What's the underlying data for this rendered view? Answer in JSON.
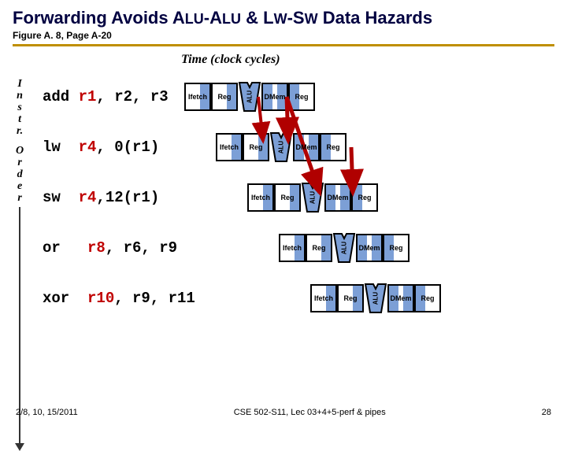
{
  "title": {
    "main_a": "Forwarding Avoids A",
    "main_b": "-A",
    "main_c": " & L",
    "main_d": "-S",
    "main_e": " Data Hazards",
    "sc_alu1": "LU",
    "sc_alu2": "LU",
    "sc_lw": "W",
    "sc_sw": "W"
  },
  "subtitle": "Figure A. 8, Page A-20",
  "time_label": "Time (clock cycles)",
  "vaxis": {
    "l1": "I\nn\ns\nt\nr.",
    "l2": "O\nr\nd\ne\nr"
  },
  "stages": {
    "if": "Ifetch",
    "reg": "Reg",
    "alu": "ALU",
    "dm": "DMem"
  },
  "instr": [
    {
      "indent": 0,
      "text": "add r1, r2, r3",
      "kw": "add",
      "rd": "r1",
      "rest": ", r2, r3"
    },
    {
      "indent": 1,
      "text": "lw  r4, 0(r1)",
      "kw": "lw ",
      "rd": "r4",
      "rest": ", 0(r1)"
    },
    {
      "indent": 2,
      "text": "sw  r4,12(r1)",
      "kw": "sw ",
      "rd": "r4",
      "rest": ",12(r1)"
    },
    {
      "indent": 3,
      "text": "or   r8, r6, r9",
      "kw": "or ",
      "rd": " r8",
      "rest": ", r6, r9"
    },
    {
      "indent": 4,
      "text": "xor r10, r9, r11",
      "kw": "xor",
      "rd": " r10",
      "rest": ", r9, r11"
    }
  ],
  "footer": {
    "left": "2/8, 10, 15/2011",
    "mid": "CSE 502-S11, Lec 03+4+5-perf & pipes",
    "right": "28"
  }
}
